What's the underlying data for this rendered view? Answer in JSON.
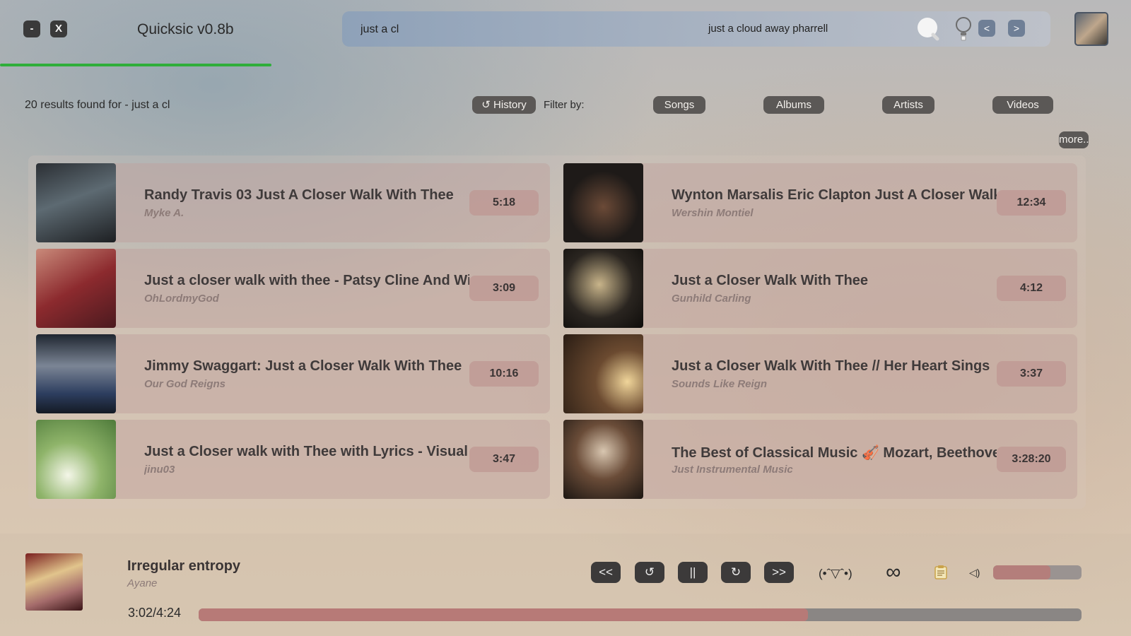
{
  "window": {
    "minimize_label": "-",
    "close_label": "X",
    "title": "Quicksic v0.8b"
  },
  "loading": {
    "progress": 0.24,
    "color": "#2fae3a"
  },
  "search": {
    "query": "just a cl",
    "suggestion": "just a cloud away pharrell",
    "prev_label": "<",
    "next_label": ">"
  },
  "results": {
    "summary": "20 results found for - just a cl",
    "history_label": "↺ History",
    "filter_label": "Filter by:",
    "filters": [
      "Songs",
      "Albums",
      "Artists",
      "Videos"
    ],
    "more_label": "more..",
    "items": [
      {
        "title": "Randy Travis 03 Just A Closer Walk With Thee",
        "artist": "Myke A.",
        "duration": "5:18"
      },
      {
        "title": "Wynton Marsalis Eric Clapton Just A Closer Walk With Thee",
        "artist": "Wershin Montiel",
        "duration": "12:34"
      },
      {
        "title": "Just a closer walk with thee - Patsy Cline And Willie Nelson",
        "artist": "OhLordmyGod",
        "duration": "3:09"
      },
      {
        "title": "Just a Closer Walk With Thee",
        "artist": "Gunhild Carling",
        "duration": "4:12"
      },
      {
        "title": "Jimmy Swaggart: Just a Closer Walk With Thee",
        "artist": "Our God Reigns",
        "duration": "10:16"
      },
      {
        "title": "Just a Closer Walk With Thee // Her Heart Sings",
        "artist": "Sounds Like Reign",
        "duration": "3:37"
      },
      {
        "title": "Just a Closer walk with Thee with Lyrics - Visual Worship",
        "artist": "jinu03",
        "duration": "3:47"
      },
      {
        "title": "The Best of Classical Music 🎻 Mozart, Beethoven, Vivaldi",
        "artist": "Just Instrumental Music",
        "duration": "3:28:20"
      }
    ]
  },
  "player": {
    "title": "Irregular entropy",
    "artist": "Ayane",
    "time": "3:02/4:24",
    "progress": 0.69,
    "controls": {
      "rewind": "<<",
      "replay": "↺",
      "pause": "||",
      "forward_loop": "↻",
      "skip": ">>"
    },
    "emote": "(•ˆ▽ˆ•)",
    "loop": "∞",
    "volume_label": "◁)",
    "volume": 0.65
  },
  "colors": {
    "accent": "#2fae3a",
    "chip": "#5b5856",
    "progress": "#b77a77"
  }
}
